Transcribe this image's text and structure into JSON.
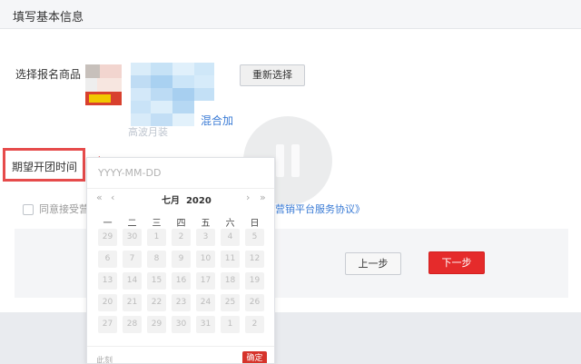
{
  "header": {
    "title": "填写基本信息"
  },
  "product": {
    "label": "选择报名商品",
    "name_fragment": "混合加",
    "sub_fragment": "高波月装",
    "reselect_label": "重新选择"
  },
  "date_field": {
    "label": "期望开团时间",
    "placeholder": "YYYY-MM-DD"
  },
  "agreement": {
    "prefix": "同意接受营",
    "link": "营销平台服务协议》"
  },
  "actions": {
    "prev_label": "上一步",
    "next_label": "下一步"
  },
  "colors": {
    "accent": "#e52b2b",
    "highlight": "#e64b4b",
    "link": "#3a7bd5"
  },
  "calendar": {
    "nav": {
      "prev_year": "«",
      "prev_month": "‹",
      "next_month": "›",
      "next_year": "»"
    },
    "month": "七月",
    "year": "2020",
    "weekdays": [
      "一",
      "二",
      "三",
      "四",
      "五",
      "六",
      "日"
    ],
    "days": [
      "29",
      "30",
      "1",
      "2",
      "3",
      "4",
      "5",
      "6",
      "7",
      "8",
      "9",
      "10",
      "11",
      "12",
      "13",
      "14",
      "15",
      "16",
      "17",
      "18",
      "19",
      "20",
      "21",
      "22",
      "23",
      "24",
      "25",
      "26",
      "27",
      "28",
      "29",
      "30",
      "31",
      "1",
      "2"
    ],
    "now_label": "此刻",
    "confirm_label": "确定"
  },
  "icons": {
    "arrow": "arrow-left-icon",
    "pause": "pause-icon"
  }
}
